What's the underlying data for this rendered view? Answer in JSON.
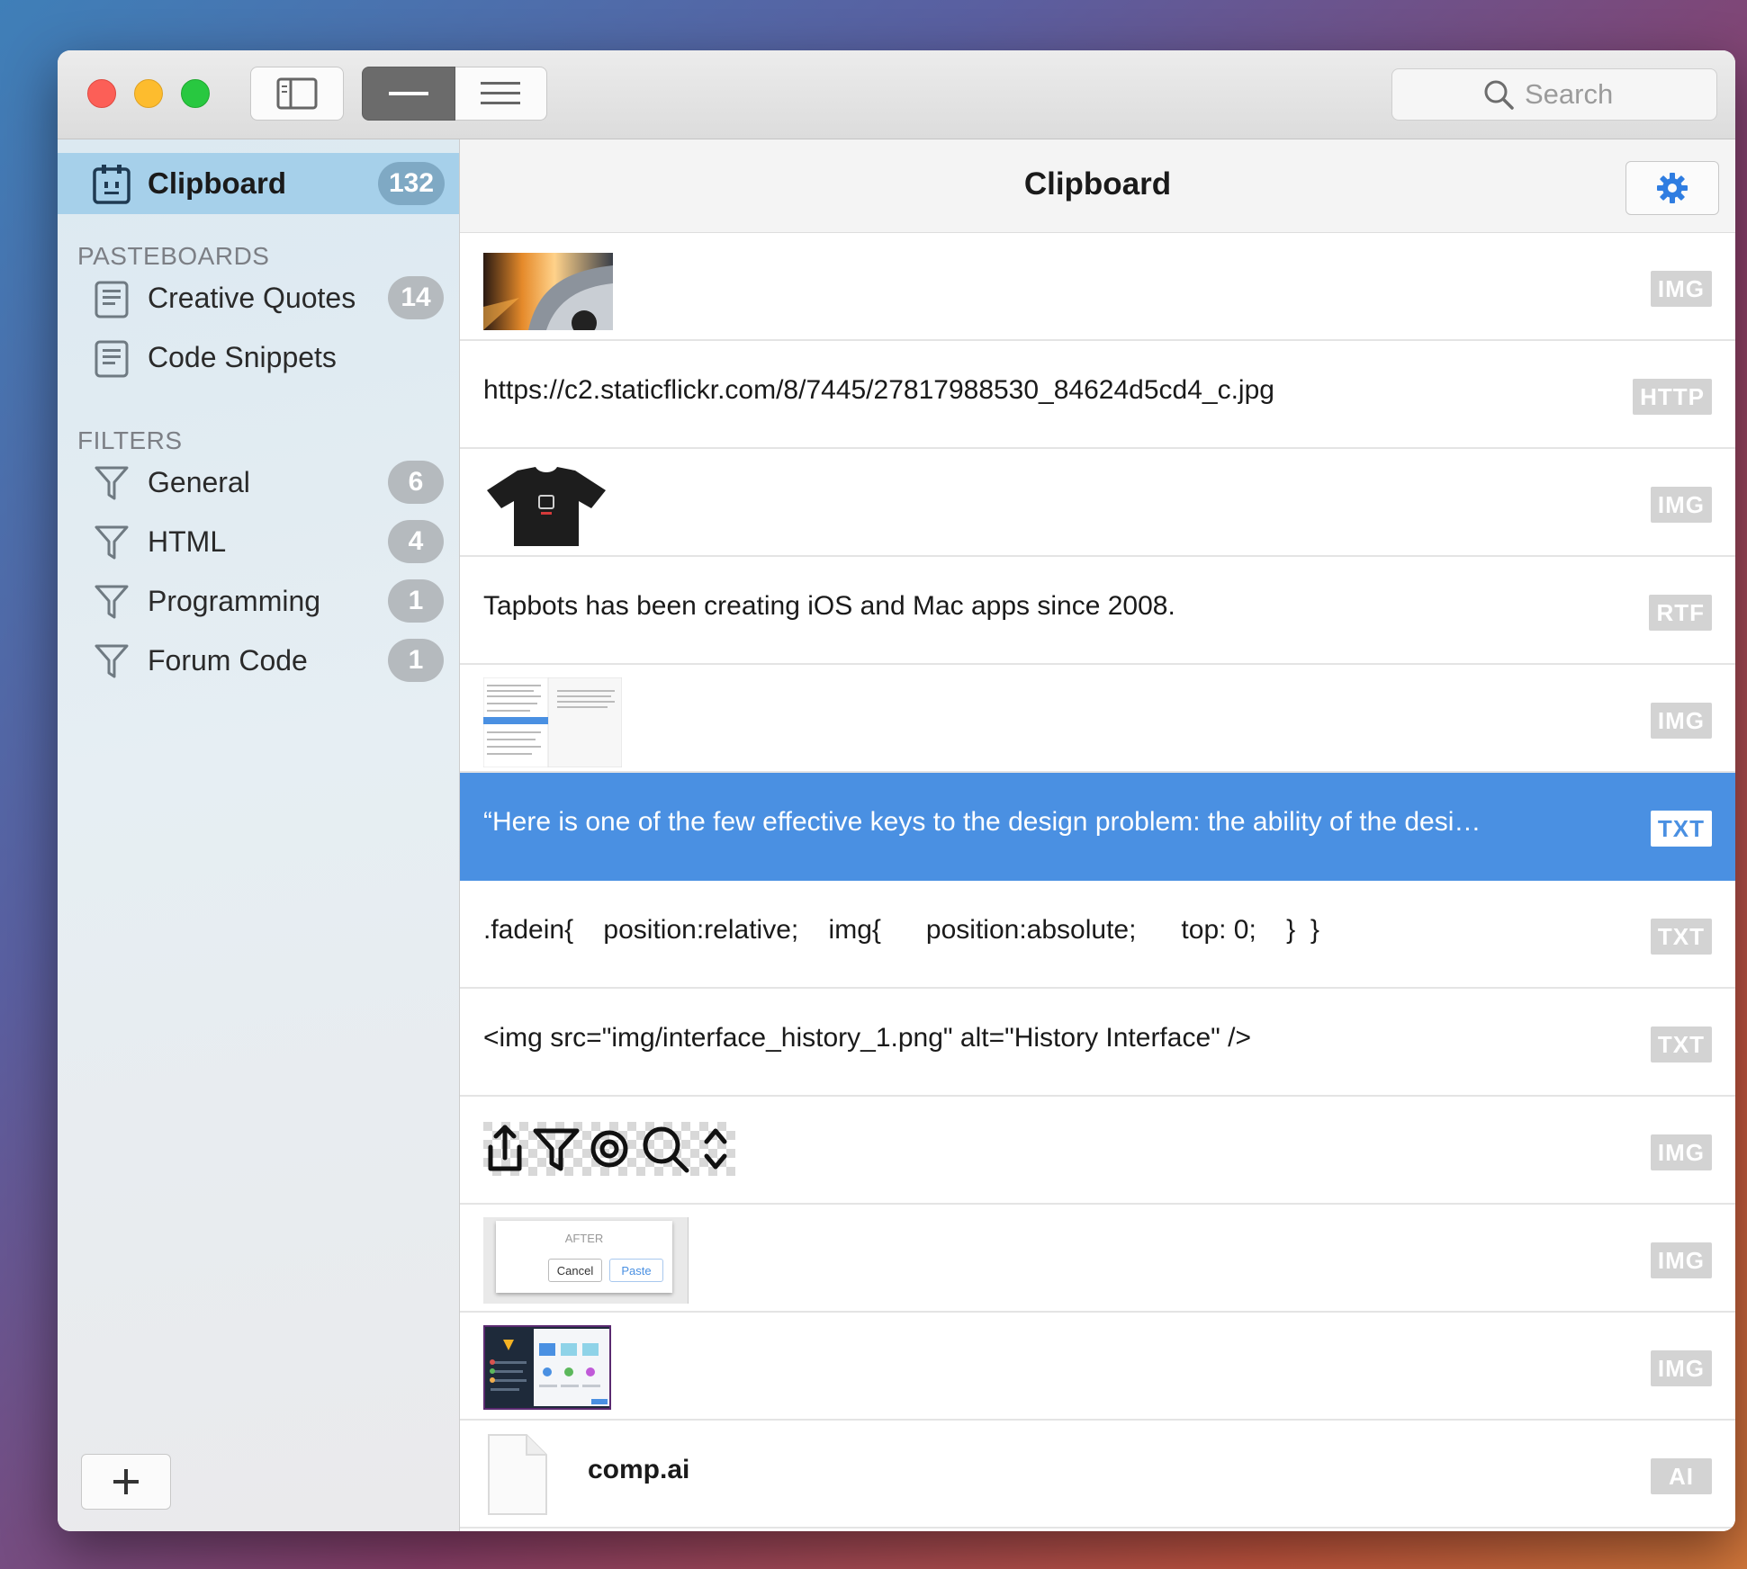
{
  "search": {
    "placeholder": "Search"
  },
  "sidebar": {
    "main": {
      "label": "Clipboard",
      "count": "132"
    },
    "pasteboards_header": "PASTEBOARDS",
    "pasteboards": [
      {
        "label": "Creative Quotes",
        "count": "14"
      },
      {
        "label": "Code Snippets",
        "count": ""
      }
    ],
    "filters_header": "FILTERS",
    "filters": [
      {
        "label": "General",
        "count": "6"
      },
      {
        "label": "HTML",
        "count": "4"
      },
      {
        "label": "Programming",
        "count": "1"
      },
      {
        "label": "Forum Code",
        "count": "1"
      }
    ],
    "add_label": "+"
  },
  "main": {
    "title": "Clipboard",
    "rows": [
      {
        "kind": "image",
        "desc": "car-photo-thumbnail",
        "tag": "IMG"
      },
      {
        "kind": "text",
        "text": "https://c2.staticflickr.com/8/7445/27817988530_84624d5cd4_c.jpg",
        "tag": "HTTP"
      },
      {
        "kind": "image",
        "desc": "tshirt-thumbnail",
        "tag": "IMG"
      },
      {
        "kind": "text",
        "text": "Tapbots has been creating iOS and Mac apps since 2008.",
        "tag": "RTF"
      },
      {
        "kind": "image",
        "desc": "document-screenshot-thumbnail",
        "tag": "IMG"
      },
      {
        "kind": "text",
        "text": "“Here is one of the few effective keys to the design problem: the ability of the desi…",
        "tag": "TXT",
        "selected": true
      },
      {
        "kind": "text",
        "text": ".fadein{    position:relative;    img{      position:absolute;      top: 0;    }  }",
        "tag": "TXT"
      },
      {
        "kind": "text",
        "text": "<img src=\"img/interface_history_1.png\" alt=\"History Interface\" />",
        "tag": "TXT"
      },
      {
        "kind": "image",
        "desc": "toolbar-icons-thumbnail",
        "tag": "IMG"
      },
      {
        "kind": "image",
        "desc": "dialog-screenshot-thumbnail",
        "tag": "IMG",
        "dialog_heading": "AFTER",
        "dialog_cancel": "Cancel",
        "dialog_paste": "Paste"
      },
      {
        "kind": "image",
        "desc": "app-screenshot-thumbnail",
        "tag": "IMG"
      },
      {
        "kind": "file",
        "text": "comp.ai",
        "tag": "AI"
      }
    ]
  },
  "colors": {
    "accent": "#4a90e2",
    "sidebar_selected": "#a6d0ea",
    "tag_gray": "#d3d3d3"
  }
}
